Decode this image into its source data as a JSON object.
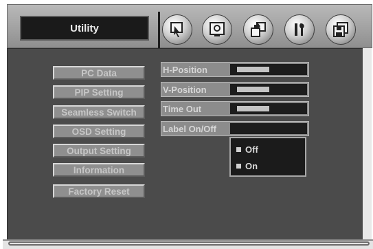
{
  "header": {
    "title": "Utility",
    "icons": [
      "picture-adjust-icon",
      "display-icon",
      "input-source-icon",
      "tools-icon",
      "save-icon"
    ]
  },
  "menu": {
    "items": [
      {
        "label": "PC Data"
      },
      {
        "label": "PIP Setting"
      },
      {
        "label": "Seamless Switch"
      },
      {
        "label": "OSD Setting"
      },
      {
        "label": "Output Setting"
      },
      {
        "label": "Information"
      },
      {
        "label": "Factory Reset"
      }
    ]
  },
  "settings": {
    "rows": [
      {
        "label": "H-Position",
        "level": 0.42
      },
      {
        "label": "V-Position",
        "level": 0.42
      },
      {
        "label": "Time Out",
        "level": 0.42
      },
      {
        "label": "Label On/Off"
      }
    ]
  },
  "dropdown": {
    "options": [
      {
        "label": "Off"
      },
      {
        "label": "On"
      }
    ]
  },
  "colors": {
    "panel": "#4b4b4b",
    "button_face": "#8f8f8f",
    "field_dark": "#1d1d1d"
  }
}
